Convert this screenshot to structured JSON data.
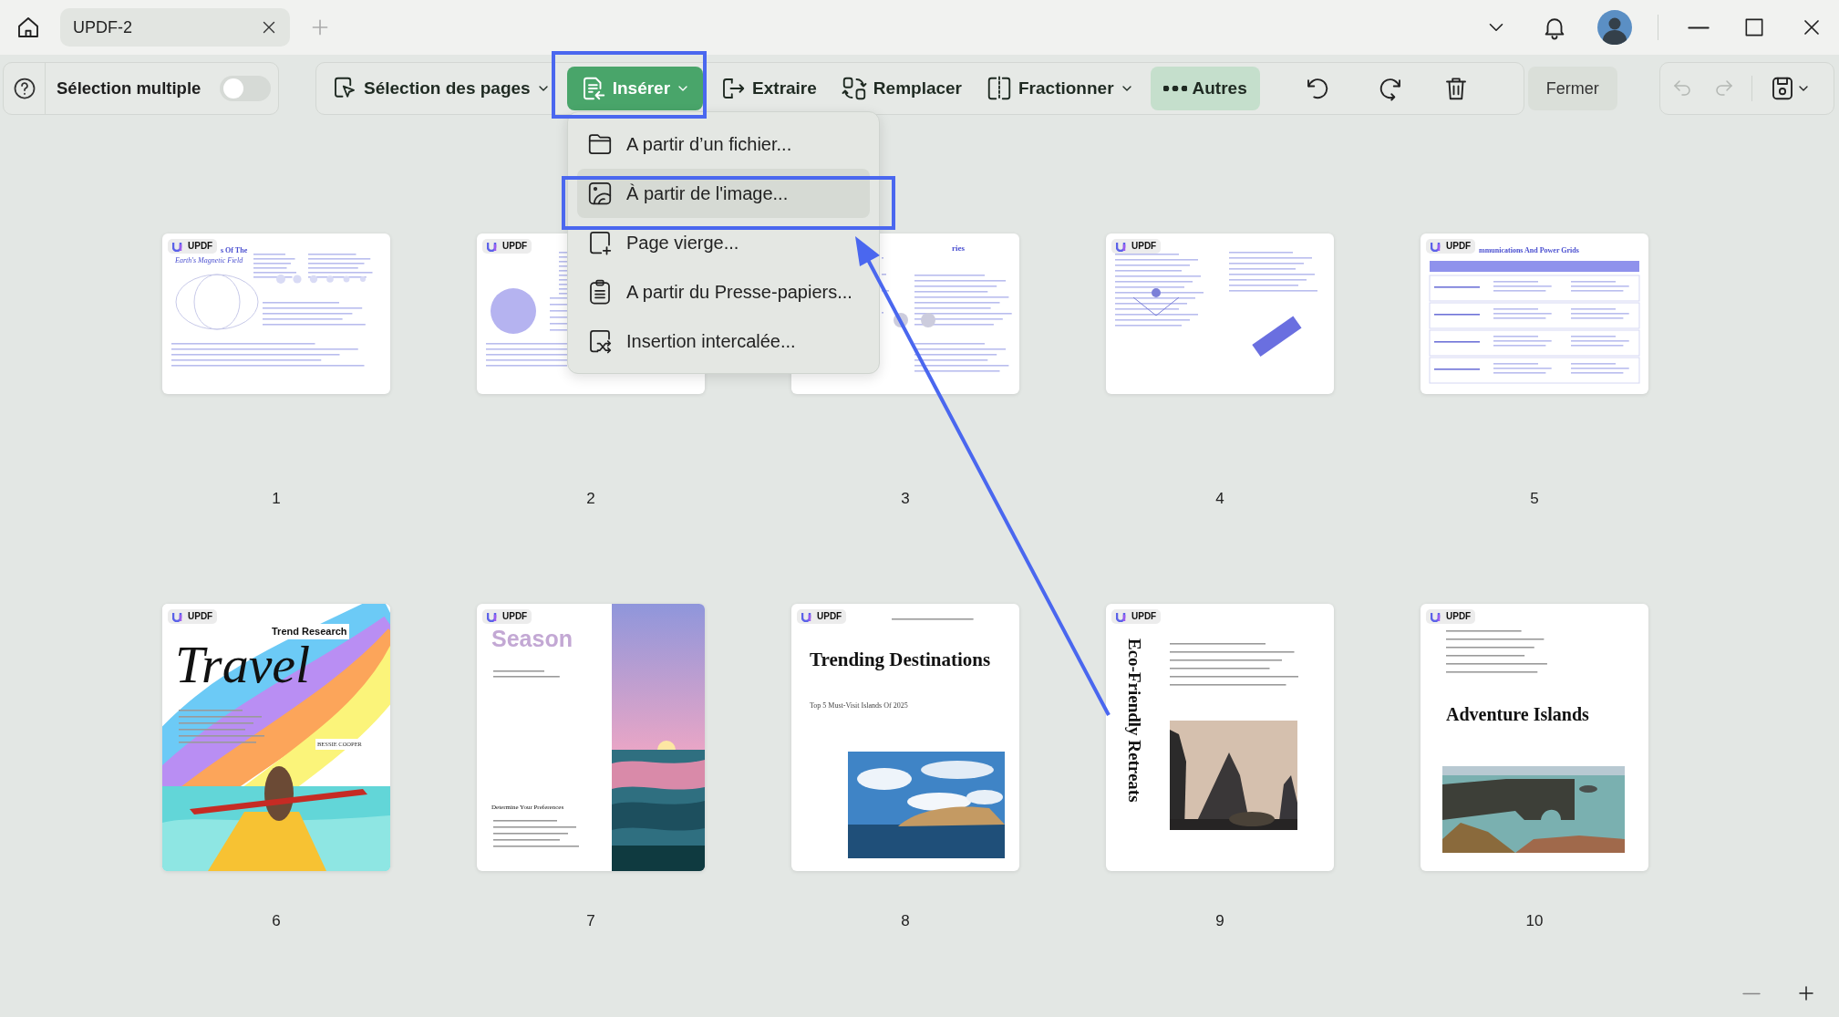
{
  "tabs": [
    {
      "label": "UPDF-2",
      "selected": true
    }
  ],
  "toolbar": {
    "help": {
      "kind": "help"
    },
    "multi_select": {
      "label": "Sélection multiple",
      "on": false
    },
    "tools": [
      {
        "label": "Sélection des pages",
        "kind": "plain",
        "dropdown": true
      },
      {
        "label": "Insérer",
        "kind": "primary",
        "dropdown": true
      },
      {
        "label": "Extraire",
        "kind": "plain",
        "dropdown": false
      },
      {
        "label": "Remplacer",
        "kind": "plain",
        "dropdown": false
      },
      {
        "label": "Fractionner",
        "kind": "plain",
        "dropdown": true
      },
      {
        "label": "Autres",
        "kind": "soft",
        "dropdown": false
      }
    ],
    "close_button": {
      "label": "Fermer"
    },
    "history": [
      {
        "disabled": true
      },
      {
        "disabled": true
      }
    ]
  },
  "insert_menu": {
    "items": [
      {
        "label": "A partir d’un fichier...",
        "selected": false
      },
      {
        "label": "À partir de l'image...",
        "selected": true
      },
      {
        "label": "Page vierge...",
        "selected": false
      },
      {
        "label": "A partir du Presse-papiers...",
        "selected": false
      },
      {
        "label": "Insertion intercalée...",
        "selected": false
      }
    ]
  },
  "pages": [
    {
      "number": "1",
      "kind": "report",
      "badge": "UPDF",
      "title": "s Of The",
      "subtitle": "Earth's Magnetic Field"
    },
    {
      "number": "2",
      "kind": "report",
      "badge": "UPDF"
    },
    {
      "number": "3",
      "kind": "report",
      "title": "ries"
    },
    {
      "number": "4",
      "kind": "report",
      "badge": "UPDF"
    },
    {
      "number": "5",
      "kind": "report",
      "badge": "UPDF",
      "title": "mmunications And Power Grids"
    },
    {
      "number": "6",
      "kind": "travel",
      "badge": "UPDF",
      "title": "Travel",
      "subtitle": "Trend Research",
      "author": "BESSIE COOPER"
    },
    {
      "number": "7",
      "kind": "season",
      "badge": "UPDF",
      "title": "Season",
      "heading": "Determine Your Preferences"
    },
    {
      "number": "8",
      "kind": "destinations",
      "badge": "UPDF",
      "title": "Trending Destinations",
      "subtitle": "Top 5 Must-Visit Islands Of 2025"
    },
    {
      "number": "9",
      "kind": "retreats",
      "badge": "UPDF",
      "title": "Eco-Friendly Retreats"
    },
    {
      "number": "10",
      "kind": "islands",
      "badge": "UPDF",
      "title": "Adventure Islands"
    }
  ]
}
